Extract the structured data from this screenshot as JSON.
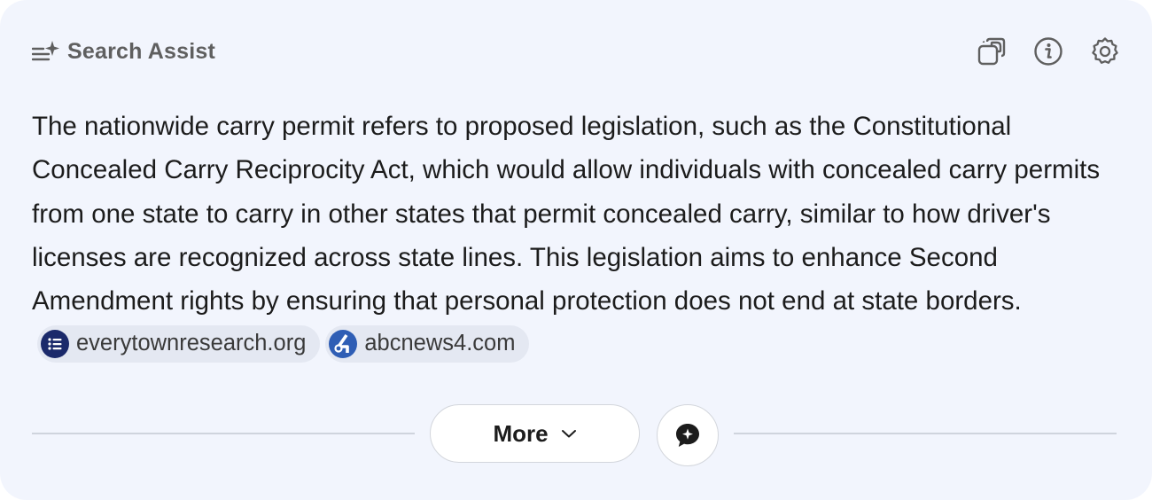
{
  "header": {
    "title": "Search Assist",
    "icons": [
      "sparkle-list-icon",
      "copy-icon",
      "info-icon",
      "settings-icon"
    ]
  },
  "answer": {
    "text": "The nationwide carry permit refers to proposed legislation, such as the Constitutional Concealed Carry Reciprocity Act, which would allow individuals with concealed carry permits from one state to carry in other states that permit concealed carry, similar to how driver's licenses are recognized across state lines. This legislation aims to enhance Second Amendment rights by ensuring that personal protection does not end at state borders."
  },
  "sources": [
    {
      "label": "everytownresearch.org",
      "icon": "list-favicon",
      "color": "#1b2a6b"
    },
    {
      "label": "abcnews4.com",
      "icon": "abc4-favicon",
      "color": "#2f5eb5"
    }
  ],
  "footer": {
    "more_label": "More",
    "chat_icon": "chat-sparkle-icon"
  },
  "colors": {
    "background": "#f2f5fd",
    "chip": "#e4e8f2",
    "divider": "#cfd4dd"
  }
}
